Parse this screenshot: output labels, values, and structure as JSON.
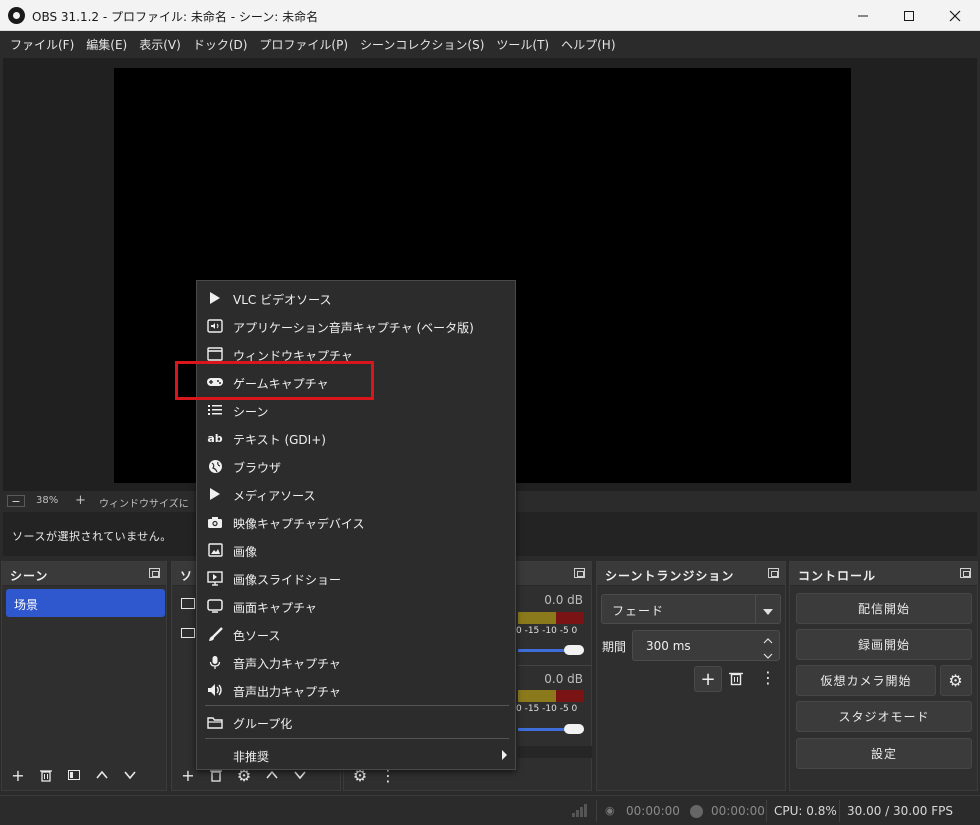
{
  "window": {
    "title": "OBS 31.1.2 - プロファイル: 未命名 - シーン: 未命名",
    "minimize_icon": "minimize-icon",
    "maximize_icon": "maximize-icon",
    "close_icon": "close-icon"
  },
  "menubar": [
    "ファイル(F)",
    "編集(E)",
    "表示(V)",
    "ドック(D)",
    "プロファイル(P)",
    "シーンコレクション(S)",
    "ツール(T)",
    "ヘルプ(H)"
  ],
  "zoom": {
    "minus": "−",
    "value": "38%",
    "plus": "+",
    "fit_label": "ウィンドウサイズに"
  },
  "source_status": "ソースが選択されていません。",
  "scenes": {
    "title": "シーン",
    "items": [
      "场景"
    ]
  },
  "sources": {
    "title": "ソ"
  },
  "mixer": {
    "tracks": [
      {
        "db": "0.0 dB",
        "scale": "0 -15 -10 -5 0"
      },
      {
        "db": "0.0 dB",
        "scale": "0 -15 -10 -5 0"
      }
    ]
  },
  "transitions": {
    "title": "シーントランジション",
    "selected": "フェード",
    "duration_label": "期間",
    "duration_value": "300 ms"
  },
  "controls": {
    "title": "コントロール",
    "start_stream": "配信開始",
    "start_record": "録画開始",
    "virtual_camera": "仮想カメラ開始",
    "studio_mode": "スタジオモード",
    "settings": "設定"
  },
  "statusbar": {
    "stream_time": "00:00:00",
    "record_time": "00:00:00",
    "cpu": "CPU: 0.8%",
    "fps": "30.00 / 30.00 FPS"
  },
  "context_menu": {
    "items": [
      {
        "label": "VLC ビデオソース",
        "icon": "play-icon"
      },
      {
        "label": "アプリケーション音声キャプチャ (ベータ版)",
        "icon": "app-audio-icon"
      },
      {
        "label": "ウィンドウキャプチャ",
        "icon": "window-icon"
      },
      {
        "label": "ゲームキャプチャ",
        "icon": "gamepad-icon"
      },
      {
        "label": "シーン",
        "icon": "list-icon"
      },
      {
        "label": "テキスト (GDI+)",
        "icon": "text-icon"
      },
      {
        "label": "ブラウザ",
        "icon": "globe-icon"
      },
      {
        "label": "メディアソース",
        "icon": "media-play-icon"
      },
      {
        "label": "映像キャプチャデバイス",
        "icon": "camera-icon"
      },
      {
        "label": "画像",
        "icon": "image-icon"
      },
      {
        "label": "画像スライドショー",
        "icon": "slideshow-icon"
      },
      {
        "label": "画面キャプチャ",
        "icon": "monitor-icon"
      },
      {
        "label": "色ソース",
        "icon": "brush-icon"
      },
      {
        "label": "音声入力キャプチャ",
        "icon": "microphone-icon"
      },
      {
        "label": "音声出力キャプチャ",
        "icon": "speaker-icon"
      }
    ],
    "group": {
      "label": "グループ化",
      "icon": "folder-icon"
    },
    "deprecated": {
      "label": "非推奨",
      "icon": "arrow-right-icon"
    }
  }
}
